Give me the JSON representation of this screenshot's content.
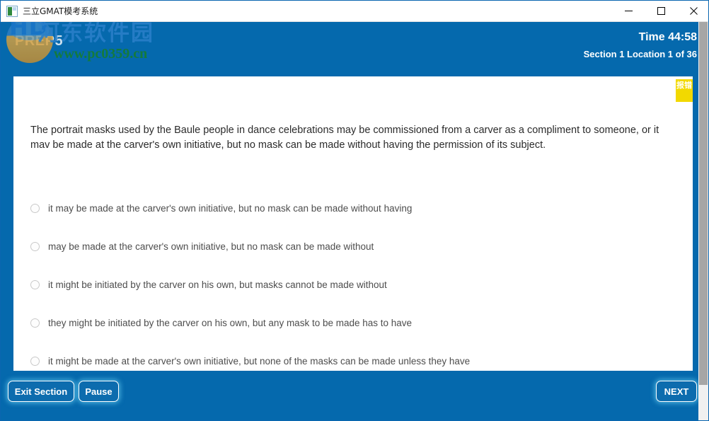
{
  "window": {
    "title": "三立GMAT模考系统",
    "icon": "app-icon",
    "minimize_label": "—",
    "maximize_label": "□",
    "close_label": "✕"
  },
  "header": {
    "brand": "PREP5",
    "time": "Time 44:58",
    "location": "Section 1 Location 1 of 36"
  },
  "watermark": {
    "logo_text": "HD",
    "site_name": "河东软件园",
    "url": "www.pc0359.cn"
  },
  "question": {
    "report_badge": "报错",
    "stem": "The portrait masks used by the Baule people in dance celebrations may be commissioned from a carver as a compliment to someone, or it mav be made at the carver's own initiative, but no mask can be made without having the permission of its subject.",
    "options": [
      {
        "id": "A",
        "text": "it may be made at the carver's own initiative, but no mask can be made without having",
        "selected": false
      },
      {
        "id": "B",
        "text": "may be made at the carver's own initiative, but no mask can be made without",
        "selected": false
      },
      {
        "id": "C",
        "text": "it might be initiated by the carver on his own, but masks cannot be made without",
        "selected": false
      },
      {
        "id": "D",
        "text": "they might be initiated by the carver on his own, but any mask to be made has to have",
        "selected": false
      },
      {
        "id": "E",
        "text": "it might be made at the carver's own initiative, but none of the masks can be made unless they have",
        "selected": false
      }
    ]
  },
  "footer": {
    "exit_section": "Exit Section",
    "pause": "Pause",
    "next": "NEXT"
  },
  "colors": {
    "app_blue": "#0569ad",
    "badge_yellow": "#f2d900",
    "panel_white": "#ffffff",
    "watermark_green": "#147a3c"
  }
}
